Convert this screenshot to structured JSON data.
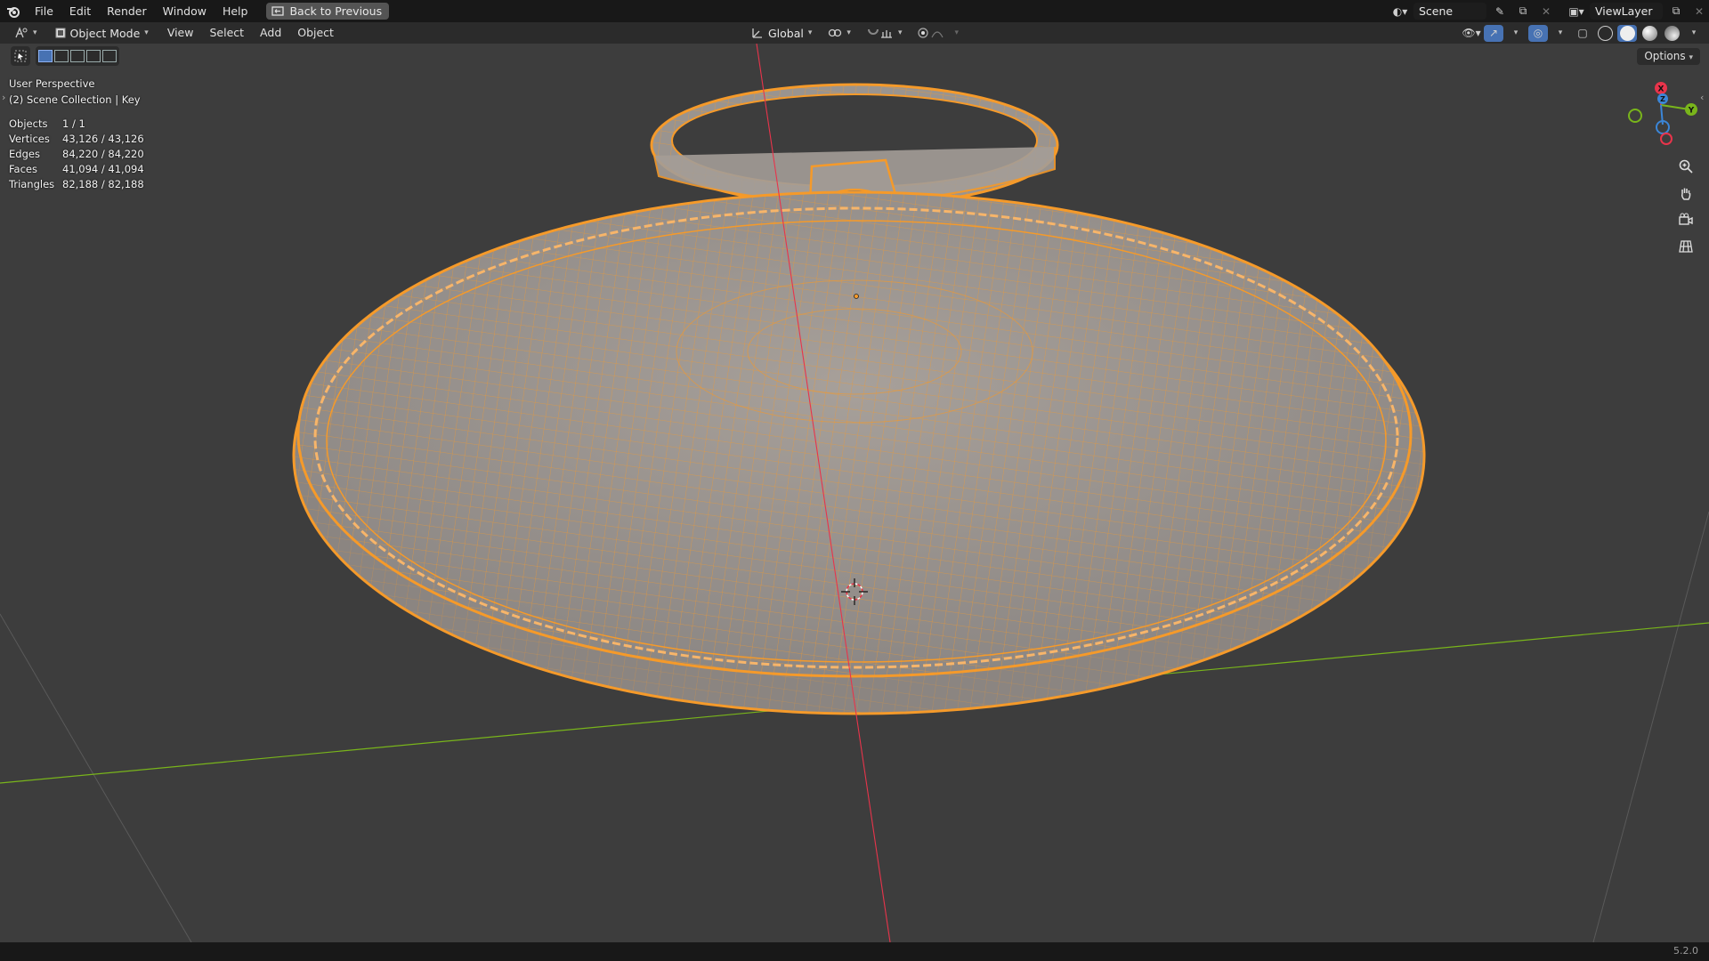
{
  "topbar": {
    "menus": [
      "File",
      "Edit",
      "Render",
      "Window",
      "Help"
    ],
    "back_label": "Back to Previous",
    "scene_name": "Scene",
    "view_layer": "ViewLayer"
  },
  "header": {
    "mode": "Object Mode",
    "menus": [
      "View",
      "Select",
      "Add",
      "Object"
    ],
    "transform_orientation": "Global",
    "options_label": "Options"
  },
  "overlay": {
    "perspective": "User Perspective",
    "collection": "(2) Scene Collection | Key",
    "stats": [
      {
        "label": "Objects",
        "value": "1 / 1"
      },
      {
        "label": "Vertices",
        "value": "43,126 / 43,126"
      },
      {
        "label": "Edges",
        "value": "84,220 / 84,220"
      },
      {
        "label": "Faces",
        "value": "41,094 / 41,094"
      },
      {
        "label": "Triangles",
        "value": "82,188 / 82,188"
      }
    ]
  },
  "gizmo": {
    "x": "X",
    "y": "Y",
    "z": "Z"
  },
  "icons": [
    "blender-logo-icon",
    "screen-icon",
    "editor-type-icon",
    "object-mode-icon",
    "transform-orientation-icon",
    "pivot-icon",
    "snap-icon",
    "proportional-icon",
    "visibility-icon",
    "gizmo-icon",
    "overlay-icon",
    "xray-icon",
    "wireframe-shading-icon",
    "solid-shading-icon",
    "material-shading-icon",
    "rendered-shading-icon",
    "zoom-icon",
    "hand-pan-icon",
    "camera-icon",
    "ortho-grid-icon",
    "select-tool-icon",
    "3d-cursor-icon"
  ],
  "colors": {
    "accent": "#4772b3",
    "selection": "#f59a2a",
    "x_axis": "#e8344b",
    "y_axis": "#79b51b",
    "z_axis": "#3b86d8"
  },
  "statusbar": {
    "version": "5.2.0"
  }
}
